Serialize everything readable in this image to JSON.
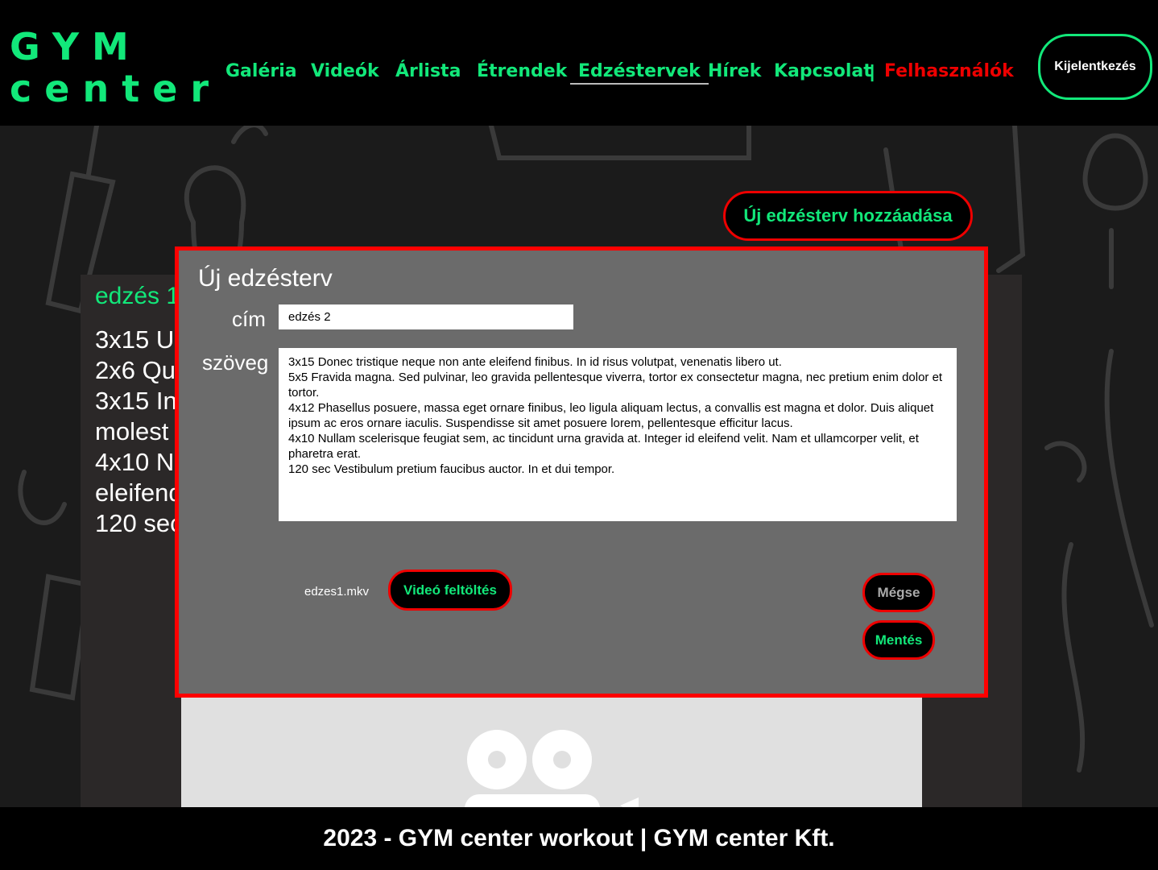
{
  "logo": {
    "line1": "GYM",
    "line2": "center"
  },
  "nav": {
    "items": [
      {
        "label": "Galéria"
      },
      {
        "label": "Videók"
      },
      {
        "label": "Árlista"
      },
      {
        "label": "Étrendek"
      },
      {
        "label": "Edzéstervek"
      },
      {
        "label": "Hírek"
      },
      {
        "label": "Kapcsolat"
      }
    ],
    "separator": "|",
    "users_label": "Felhasználók"
  },
  "header": {
    "logout_label": "Kijelentkezés"
  },
  "add_plan_button": "Új edzésterv hozzáadása",
  "card": {
    "title": "edzés 1",
    "lines": [
      "3x15 U",
      "2x6 Qu",
      "3x15 In",
      "molest",
      "4x10 N",
      "eleifend",
      "120 sec"
    ]
  },
  "modal": {
    "title": "Új edzésterv",
    "title_label": "cím",
    "title_value": "edzés 2",
    "text_label": "szöveg",
    "text_value": "3x15 Donec tristique neque non ante eleifend finibus. In id risus volutpat, venenatis libero ut.\n5x5 Fravida magna. Sed pulvinar, leo gravida pellentesque viverra, tortor ex consectetur magna, nec pretium enim dolor et tortor.\n4x12 Phasellus posuere, massa eget ornare finibus, leo ligula aliquam lectus, a convallis est magna et dolor. Duis aliquet ipsum ac eros ornare iaculis. Suspendisse sit amet posuere lorem, pellentesque efficitur lacus.\n4x10 Nullam scelerisque feugiat sem, ac tincidunt urna gravida at. Integer id eleifend velit. Nam et ullamcorper velit, et pharetra erat.\n120 sec Vestibulum pretium faucibus auctor. In et dui tempor.",
    "file_name": "edzes1.mkv",
    "upload_label": "Videó feltöltés",
    "cancel_label": "Mégse",
    "save_label": "Mentés"
  },
  "footer": {
    "text": "2023 - GYM center workout | GYM center Kft."
  },
  "colors": {
    "accent": "#12e87a",
    "danger": "#ee0000",
    "header_bg": "#000000",
    "modal_bg": "#6b6b6b"
  }
}
